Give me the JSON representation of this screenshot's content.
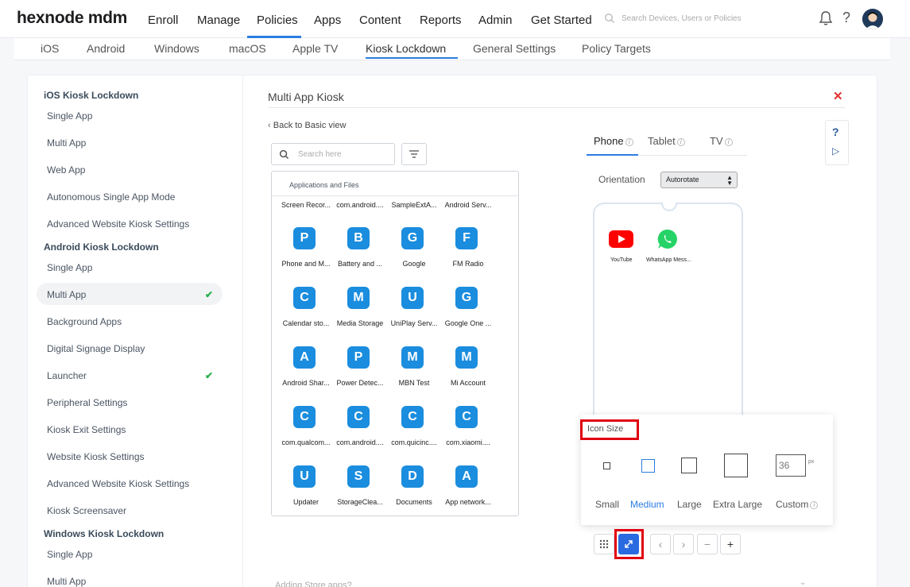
{
  "brand": {
    "logo": "hexnode mdm"
  },
  "topnav": {
    "items": [
      "Enroll",
      "Manage",
      "Policies",
      "Apps",
      "Content",
      "Reports",
      "Admin",
      "Get Started"
    ],
    "active": "Policies",
    "search_placeholder": "Search Devices, Users or Policies"
  },
  "subtabs": {
    "items": [
      "iOS",
      "Android",
      "Windows",
      "macOS",
      "Apple TV",
      "Kiosk Lockdown",
      "General Settings",
      "Policy Targets"
    ],
    "active": "Kiosk Lockdown"
  },
  "sidebar": {
    "sections": [
      {
        "heading": "iOS Kiosk Lockdown",
        "items": [
          "Single App",
          "Multi App",
          "Web App",
          "Autonomous Single App Mode",
          "Advanced Website Kiosk Settings"
        ]
      },
      {
        "heading": "Android Kiosk Lockdown",
        "items": [
          "Single App",
          "Multi App",
          "Background Apps",
          "Digital Signage Display",
          "Launcher",
          "Peripheral Settings",
          "Kiosk Exit Settings",
          "Website Kiosk Settings",
          "Advanced Website Kiosk Settings",
          "Kiosk Screensaver"
        ]
      },
      {
        "heading": "Windows Kiosk Lockdown",
        "items": [
          "Single App",
          "Multi App"
        ]
      }
    ],
    "active_item": "Multi App",
    "checked_items": [
      "Multi App",
      "Launcher"
    ]
  },
  "panel": {
    "title": "Multi App Kiosk",
    "back_link": "Back to Basic view",
    "search_placeholder": "Search here",
    "apps_header": "Applications and Files",
    "apps_top_row": [
      "Screen Recor...",
      "com.android....",
      "SampleExtA...",
      "Android Serv..."
    ],
    "apps": [
      {
        "letter": "P",
        "label": "Phone and M..."
      },
      {
        "letter": "B",
        "label": "Battery and ..."
      },
      {
        "letter": "G",
        "label": "Google"
      },
      {
        "letter": "F",
        "label": "FM Radio"
      },
      {
        "letter": "C",
        "label": "Calendar sto..."
      },
      {
        "letter": "M",
        "label": "Media Storage"
      },
      {
        "letter": "U",
        "label": "UniPlay Serv..."
      },
      {
        "letter": "G",
        "label": "Google One ..."
      },
      {
        "letter": "A",
        "label": "Android Shar..."
      },
      {
        "letter": "P",
        "label": "Power Detec..."
      },
      {
        "letter": "M",
        "label": "MBN Test"
      },
      {
        "letter": "M",
        "label": "Mi Account"
      },
      {
        "letter": "C",
        "label": "com.qualcom..."
      },
      {
        "letter": "C",
        "label": "com.android...."
      },
      {
        "letter": "C",
        "label": "com.quicinc...."
      },
      {
        "letter": "C",
        "label": "com.xiaomi...."
      },
      {
        "letter": "U",
        "label": "Updater"
      },
      {
        "letter": "S",
        "label": "StorageClea..."
      },
      {
        "letter": "D",
        "label": "Documents"
      },
      {
        "letter": "A",
        "label": "App network..."
      }
    ]
  },
  "preview": {
    "device_tabs": [
      "Phone",
      "Tablet",
      "TV"
    ],
    "active_device": "Phone",
    "orientation_label": "Orientation",
    "orientation_value": "Autorotate",
    "phone_apps": [
      "YouTube",
      "WhatsApp Mess..."
    ]
  },
  "icon_size": {
    "label": "Icon Size",
    "options": [
      "Small",
      "Medium",
      "Large",
      "Extra Large",
      "Custom"
    ],
    "selected": "Medium",
    "custom_value": "36",
    "custom_unit": "px"
  },
  "colors": {
    "accent": "#2a7de1",
    "app_icon": "#1a8ddf",
    "highlight": "#e0000f",
    "check": "#28b04a"
  },
  "footer": {
    "hint": "Adding Store apps?"
  }
}
